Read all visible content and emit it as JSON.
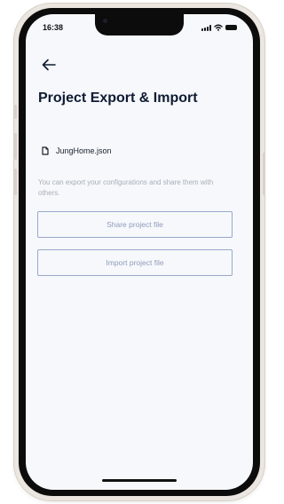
{
  "status_bar": {
    "time": "16:38",
    "icons": [
      "signal-icon",
      "wifi-icon",
      "battery-icon"
    ]
  },
  "header": {
    "back_icon": "arrow-left-icon",
    "title": "Project Export & Import"
  },
  "file": {
    "icon": "document-icon",
    "name": "JungHome.json"
  },
  "description": "You can export your configurations and share them with others.",
  "buttons": {
    "share_label": "Share project file",
    "import_label": "Import project file"
  },
  "colors": {
    "accent": "#9aa7c9",
    "title": "#0f1b33",
    "muted_text": "#a8aeb8",
    "screen_bg": "#f6f8fb"
  }
}
